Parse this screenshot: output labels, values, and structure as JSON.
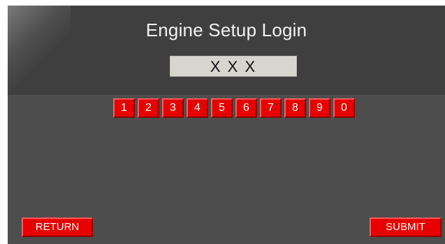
{
  "screen": {
    "title": "Engine Setup Login",
    "pin_display": "X X X"
  },
  "keypad": {
    "keys": [
      "1",
      "2",
      "3",
      "4",
      "5",
      "6",
      "7",
      "8",
      "9",
      "0"
    ]
  },
  "buttons": {
    "return_label": "RETURN",
    "submit_label": "SUBMIT"
  },
  "colors": {
    "screen_bg": "#4e4d4d",
    "header_bg": "#3f3f3f",
    "key_red": "#e80000",
    "display_bg": "#d8d5cf"
  }
}
